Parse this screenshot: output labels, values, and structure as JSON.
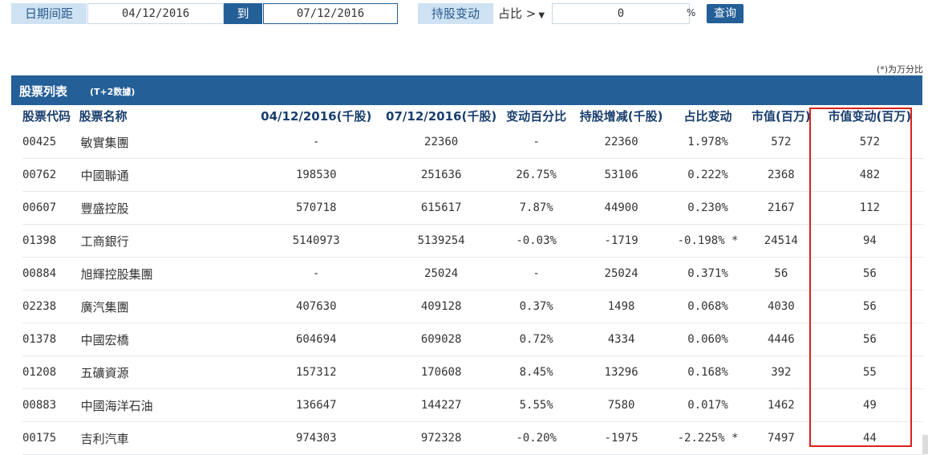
{
  "filter": {
    "date_range_label": "日期间距",
    "start_date": "04/12/2016",
    "to_label": "到",
    "end_date": "07/12/2016",
    "holding_change_label": "持股变动",
    "ratio_select": "占比 >",
    "ratio_value": "0",
    "percent_sign": "%",
    "query_button": "查询"
  },
  "note": "(*)为万分比",
  "section": {
    "title": "股票列表",
    "subtitle": "(T+2数據)"
  },
  "table": {
    "headers": [
      "股票代码",
      "股票名称",
      "04/12/2016(千股)",
      "07/12/2016(千股)",
      "变动百分比",
      "持股增减(千股)",
      "占比变动",
      "市值(百万)",
      "市值变动(百万)"
    ],
    "rows": [
      [
        "00425",
        "敏實集團",
        "-",
        "22360",
        "-",
        "22360",
        "1.978%",
        "572",
        "572"
      ],
      [
        "00762",
        "中國聯通",
        "198530",
        "251636",
        "26.75%",
        "53106",
        "0.222%",
        "2368",
        "482"
      ],
      [
        "00607",
        "豐盛控股",
        "570718",
        "615617",
        "7.87%",
        "44900",
        "0.230%",
        "2167",
        "112"
      ],
      [
        "01398",
        "工商銀行",
        "5140973",
        "5139254",
        "-0.03%",
        "-1719",
        "-0.198% *",
        "24514",
        "94"
      ],
      [
        "00884",
        "旭輝控股集團",
        "-",
        "25024",
        "-",
        "25024",
        "0.371%",
        "56",
        "56"
      ],
      [
        "02238",
        "廣汽集團",
        "407630",
        "409128",
        "0.37%",
        "1498",
        "0.068%",
        "4030",
        "56"
      ],
      [
        "01378",
        "中國宏橋",
        "604694",
        "609028",
        "0.72%",
        "4334",
        "0.060%",
        "4446",
        "56"
      ],
      [
        "01208",
        "五礦資源",
        "157312",
        "170608",
        "8.45%",
        "13296",
        "0.168%",
        "392",
        "55"
      ],
      [
        "00883",
        "中國海洋石油",
        "136647",
        "144227",
        "5.55%",
        "7580",
        "0.017%",
        "1462",
        "49"
      ],
      [
        "00175",
        "吉利汽車",
        "974303",
        "972328",
        "-0.20%",
        "-1975",
        "-2.225% *",
        "7497",
        "44"
      ]
    ]
  },
  "colors": {
    "brand_blue": "#245f97",
    "label_bg": "#cfe2f3",
    "highlight_border": "#d9211b"
  }
}
